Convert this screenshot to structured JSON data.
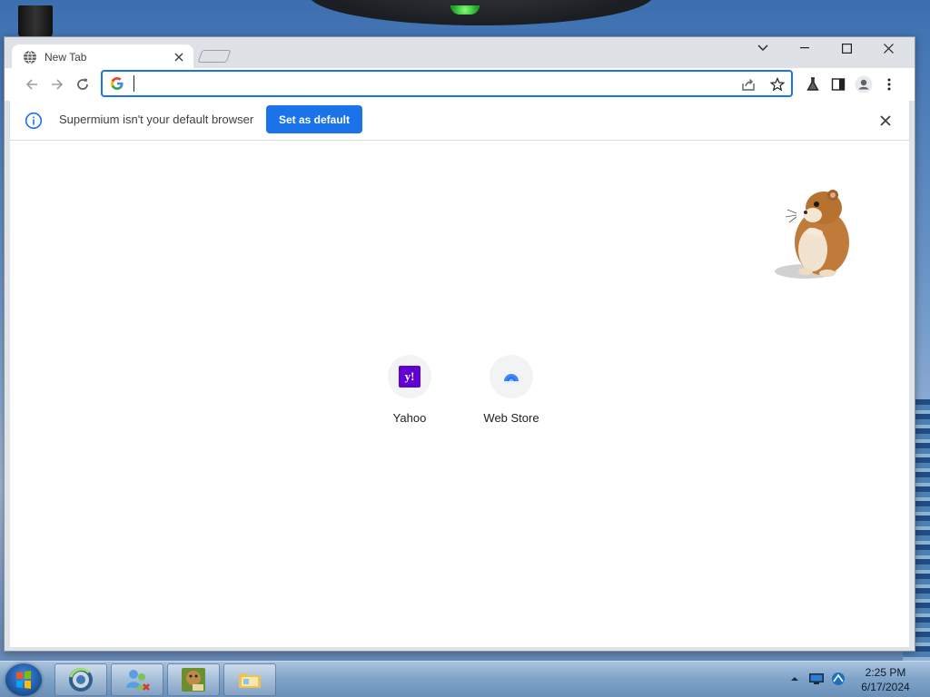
{
  "window": {
    "tab_title": "New Tab",
    "omnibox_value": ""
  },
  "infobar": {
    "message": "Supermium isn't your default browser",
    "button_label": "Set as default"
  },
  "shortcuts": [
    {
      "label": "Yahoo",
      "icon_text": "y!"
    },
    {
      "label": "Web Store"
    }
  ],
  "taskbar": {
    "time": "2:25 PM",
    "date": "6/17/2024",
    "pinned": [
      "browser-icon",
      "contacts-icon",
      "game-box-icon",
      "folder-icon"
    ]
  },
  "colors": {
    "accent": "#1a73e8",
    "yahoo": "#6001d2",
    "content_bg": "#ffffff"
  }
}
